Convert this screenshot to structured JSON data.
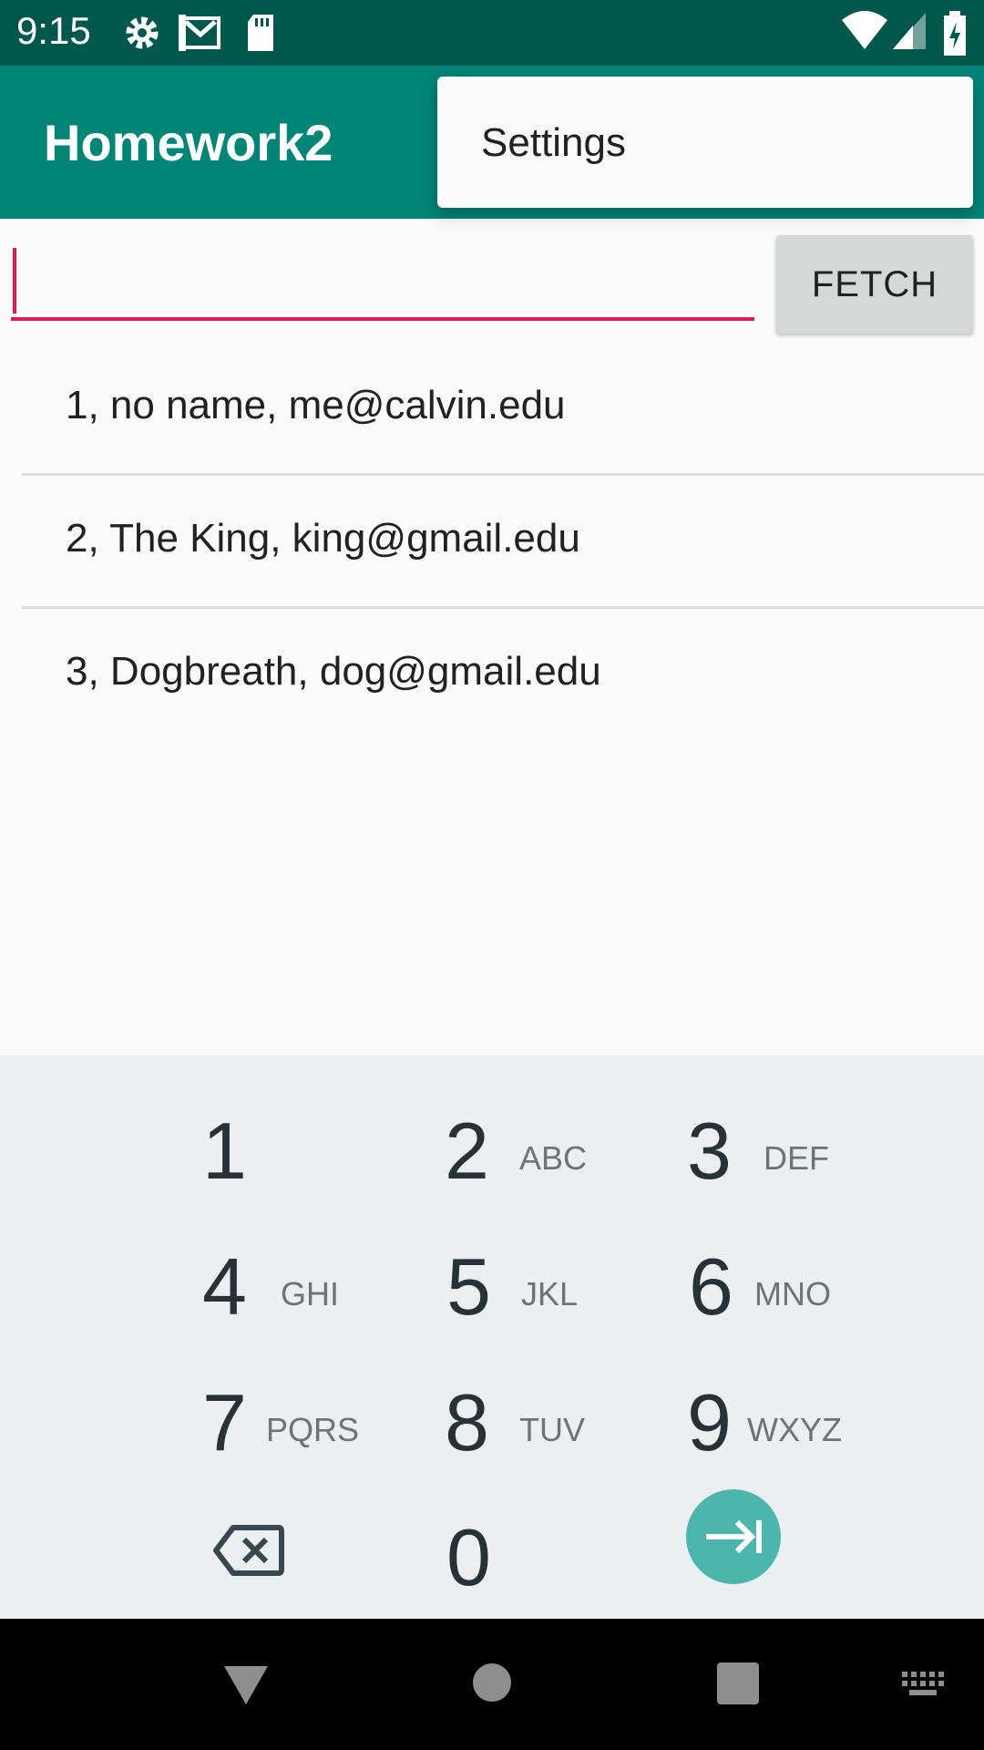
{
  "status_bar": {
    "time": "9:15",
    "left_icons": [
      "gear-icon",
      "gmail-icon",
      "sd-card-icon"
    ],
    "right_icons": [
      "wifi-icon",
      "cell-signal-icon",
      "battery-charging-icon"
    ]
  },
  "app_bar": {
    "title": "Homework2"
  },
  "overflow_menu": {
    "items": [
      {
        "label": "Settings"
      }
    ]
  },
  "search": {
    "value": "",
    "placeholder": ""
  },
  "fetch_button": {
    "label": "FETCH"
  },
  "list": {
    "items": [
      {
        "text": "1, no name, me@calvin.edu"
      },
      {
        "text": "2, The King, king@gmail.edu"
      },
      {
        "text": "3, Dogbreath, dog@gmail.edu"
      }
    ]
  },
  "keypad": {
    "keys": [
      {
        "digit": "1",
        "letters": ""
      },
      {
        "digit": "2",
        "letters": "ABC"
      },
      {
        "digit": "3",
        "letters": "DEF"
      },
      {
        "digit": "4",
        "letters": "GHI"
      },
      {
        "digit": "5",
        "letters": "JKL"
      },
      {
        "digit": "6",
        "letters": "MNO"
      },
      {
        "digit": "7",
        "letters": "PQRS"
      },
      {
        "digit": "8",
        "letters": "TUV"
      },
      {
        "digit": "9",
        "letters": "WXYZ"
      },
      {
        "digit": "0",
        "letters": ""
      }
    ],
    "backspace_icon": "backspace-icon",
    "next_icon": "tab-next-icon",
    "accent_color": "#4db6ac"
  },
  "nav_bar": {
    "icons": [
      "back-triangle-icon",
      "home-circle-icon",
      "recents-square-icon",
      "keyboard-icon"
    ]
  },
  "colors": {
    "primary": "#008577",
    "primary_dark": "#00574b",
    "accent": "#d81b60"
  }
}
